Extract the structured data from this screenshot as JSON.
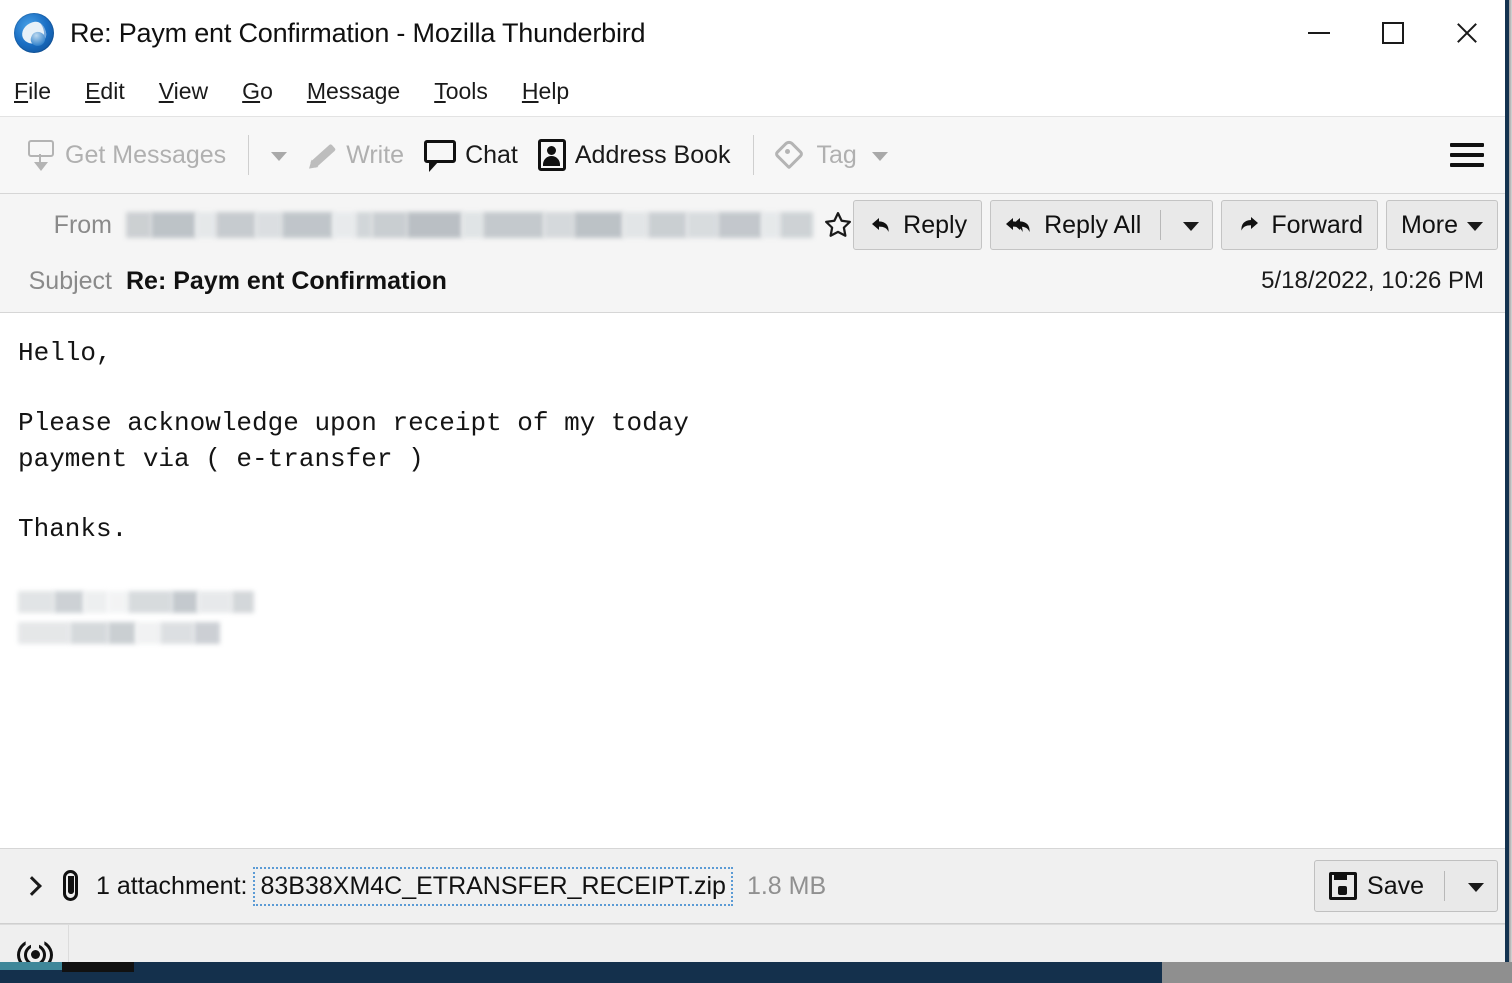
{
  "window": {
    "title": "Re: Paym ent Confirmation - Mozilla Thunderbird",
    "logo_icon": "thunderbird-logo-icon",
    "controls": {
      "minimize": "minimize-icon",
      "maximize": "maximize-icon",
      "close": "close-icon"
    }
  },
  "menubar": {
    "items": [
      {
        "label": "File",
        "accel": "F",
        "rest": "ile"
      },
      {
        "label": "Edit",
        "accel": "E",
        "rest": "dit"
      },
      {
        "label": "View",
        "accel": "V",
        "rest": "iew"
      },
      {
        "label": "Go",
        "accel": "G",
        "rest": "o"
      },
      {
        "label": "Message",
        "accel": "M",
        "rest": "essage"
      },
      {
        "label": "Tools",
        "accel": "T",
        "rest": "ools"
      },
      {
        "label": "Help",
        "accel": "H",
        "rest": "elp"
      }
    ]
  },
  "toolbar": {
    "get_messages_label": "Get Messages",
    "get_messages_enabled": false,
    "write_label": "Write",
    "write_enabled": false,
    "chat_label": "Chat",
    "address_book_label": "Address Book",
    "tag_label": "Tag",
    "tag_enabled": false,
    "app_menu_icon": "hamburger-menu-icon"
  },
  "message_header": {
    "from_label": "From",
    "from_value_redacted": true,
    "star_icon": "star-outline-icon",
    "subject_label": "Subject",
    "subject_value": "Re: Paym ent Confirmation",
    "date": "5/18/2022, 10:26 PM",
    "actions": {
      "reply": "Reply",
      "reply_all": "Reply All",
      "forward": "Forward",
      "more": "More"
    }
  },
  "message_body": {
    "greeting": "Hello,",
    "paragraph_line1": "Please acknowledge upon receipt of my today",
    "paragraph_line2": "payment via ( e-transfer )",
    "closing": "Thanks.",
    "signature_redacted": true
  },
  "attachment_bar": {
    "expand_icon": "chevron-right-icon",
    "clip_icon": "paperclip-icon",
    "count_label": "1 attachment:",
    "file_name": "83B38XM4C_ETRANSFER_RECEIPT.zip",
    "file_size": "1.8 MB",
    "save_label": "Save",
    "save_icon": "save-disk-icon",
    "selection_color": "#5b9bd5"
  },
  "statusbar": {
    "online_icon": "online-broadcast-icon"
  }
}
